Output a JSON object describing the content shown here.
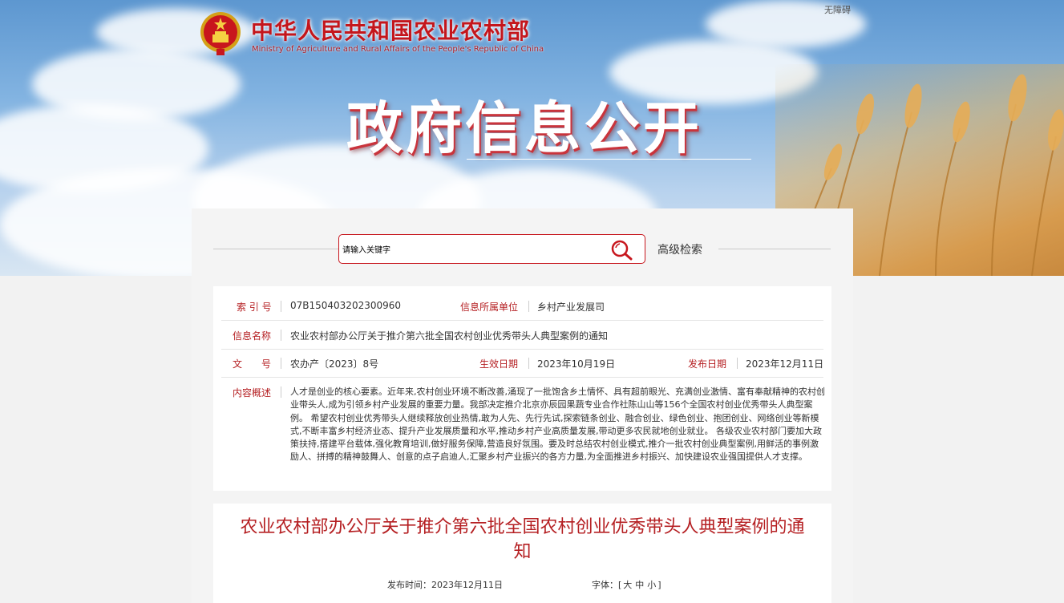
{
  "header": {
    "accessibility_link": "无障碍",
    "ministry_cn": "中华人民共和国农业农村部",
    "ministry_en": "Ministry of Agriculture and Rural Affairs of the People's Republic of China",
    "banner_title": "政府信息公开"
  },
  "search": {
    "placeholder": "请输入关键字",
    "advanced_label": "高级检索"
  },
  "info": {
    "index_label": "索 引 号",
    "index_value": "07B150403202300960",
    "org_label": "信息所属单位",
    "org_value": "乡村产业发展司",
    "name_label": "信息名称",
    "name_value": "农业农村部办公厅关于推介第六批全国农村创业优秀带头人典型案例的通知",
    "doc_label": "文　　号",
    "doc_value": "农办产〔2023〕8号",
    "effective_label": "生效日期",
    "effective_value": "2023年10月19日",
    "publish_label": "发布日期",
    "publish_value": "2023年12月11日",
    "summary_label": "内容概述",
    "summary_value": "人才是创业的核心要素。近年来,农村创业环境不断改善,涌现了一批饱含乡土情怀、具有超前眼光、充满创业激情、富有奉献精神的农村创业带头人,成为引领乡村产业发展的重要力量。我部决定推介北京亦辰园果蔬专业合作社陈山山等156个全国农村创业优秀带头人典型案例。 希望农村创业优秀带头人继续释放创业热情,敢为人先、先行先试,探索链条创业、融合创业、绿色创业、抱团创业、网络创业等新模式,不断丰富乡村经济业态、提升产业发展质量和水平,推动乡村产业高质量发展,带动更多农民就地创业就业。 各级农业农村部门要加大政策扶持,搭建平台载体,强化教育培训,做好服务保障,营造良好氛围。要及时总结农村创业模式,推介一批农村创业典型案例,用鲜活的事例激励人、拼搏的精神鼓舞人、创意的点子启迪人,汇聚乡村产业振兴的各方力量,为全面推进乡村振兴、加快建设农业强国提供人才支撑。"
  },
  "article": {
    "title": "农业农村部办公厅关于推介第六批全国农村创业优秀带头人典型案例的通知",
    "publish_time_label": "发布时间：",
    "publish_time_value": "2023年12月11日",
    "font_size_label": "字体：",
    "font_bracket_open": "[",
    "font_large": "大",
    "font_medium": "中",
    "font_small": "小",
    "font_bracket_close": "]"
  },
  "colors": {
    "brand_red": "#c4161c",
    "label_red": "#b51f22"
  }
}
